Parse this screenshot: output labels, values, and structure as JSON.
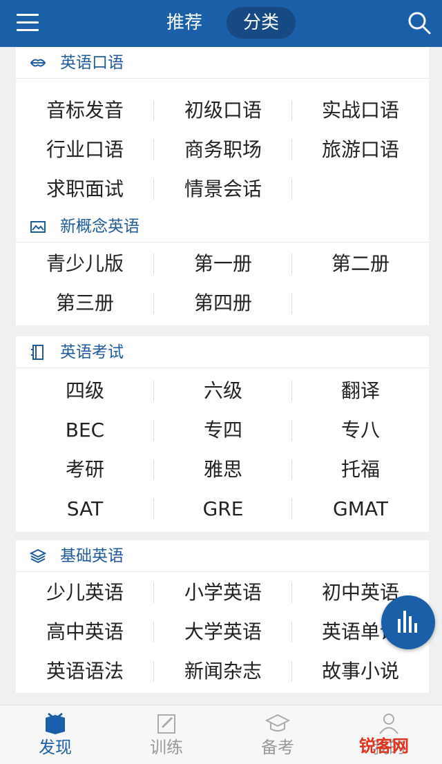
{
  "header": {
    "tab_recommend": "推荐",
    "tab_category": "分类",
    "active_tab": "分类"
  },
  "sections": [
    {
      "title": "英语口语",
      "icon": "lips-icon",
      "items": [
        "音标发音",
        "初级口语",
        "实战口语",
        "行业口语",
        "商务职场",
        "旅游口语",
        "求职面试",
        "情景会话"
      ]
    },
    {
      "title": "新概念英语",
      "icon": "picture-icon",
      "items": [
        "青少儿版",
        "第一册",
        "第二册",
        "第三册",
        "第四册"
      ]
    },
    {
      "title": "英语考试",
      "icon": "book-icon",
      "items": [
        "四级",
        "六级",
        "翻译",
        "BEC",
        "专四",
        "专八",
        "考研",
        "雅思",
        "托福",
        "SAT",
        "GRE",
        "GMAT"
      ]
    },
    {
      "title": "基础英语",
      "icon": "layers-icon",
      "items": [
        "少儿英语",
        "小学英语",
        "初中英语",
        "高中英语",
        "大学英语",
        "英语单词",
        "英语语法",
        "新闻杂志",
        "故事小说"
      ]
    }
  ],
  "bottom_nav": [
    {
      "label": "发现",
      "icon": "discover-icon",
      "active": true
    },
    {
      "label": "训练",
      "icon": "edit-icon",
      "active": false
    },
    {
      "label": "备考",
      "icon": "graduation-cap-icon",
      "active": false
    },
    {
      "label": "我的",
      "icon": "user-icon",
      "active": false
    }
  ],
  "watermark": "锐客网",
  "colors": {
    "brand": "#1b5fa8",
    "title": "#1f5b9c",
    "text": "#222222",
    "inactive": "#999999"
  }
}
